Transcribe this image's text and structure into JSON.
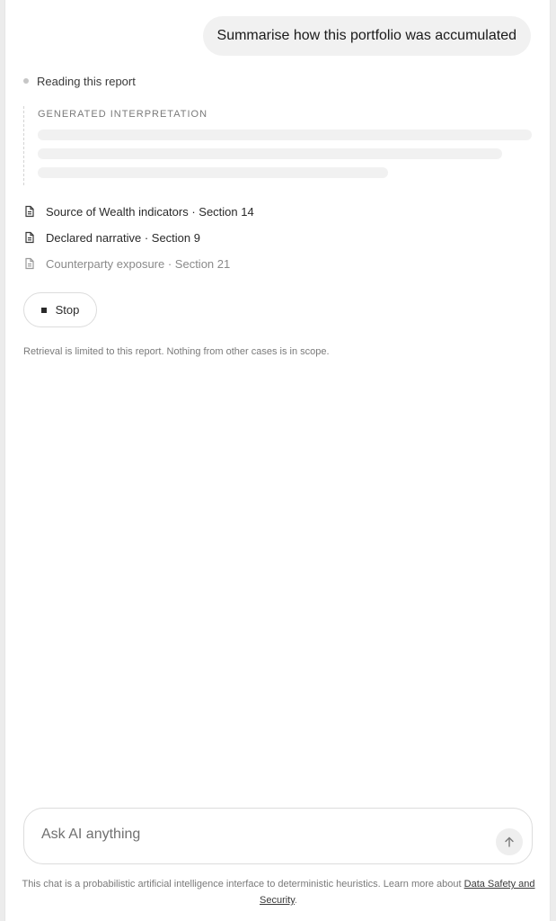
{
  "user_message": "Summarise how this portfolio was accumulated",
  "status": {
    "text": "Reading this report"
  },
  "interpretation": {
    "label": "GENERATED INTERPRETATION"
  },
  "sources": [
    {
      "label": "Source of Wealth indicators · Section 14",
      "icon": "document-icon"
    },
    {
      "label": "Declared narrative · Section 9",
      "icon": "document-icon"
    },
    {
      "label": "Counterparty exposure · Section 21",
      "icon": "document-icon"
    }
  ],
  "stop_button": {
    "label": "Stop"
  },
  "scope_note": "Retrieval is limited to this report. Nothing from other cases is in scope.",
  "composer": {
    "placeholder": "Ask AI anything",
    "value": "",
    "send_icon": "arrow-up-icon"
  },
  "disclaimer": {
    "text": "This chat is a probabilistic artificial intelligence interface to deterministic heuristics. Learn more about ",
    "link": "Data Safety and Security",
    "suffix": "."
  }
}
